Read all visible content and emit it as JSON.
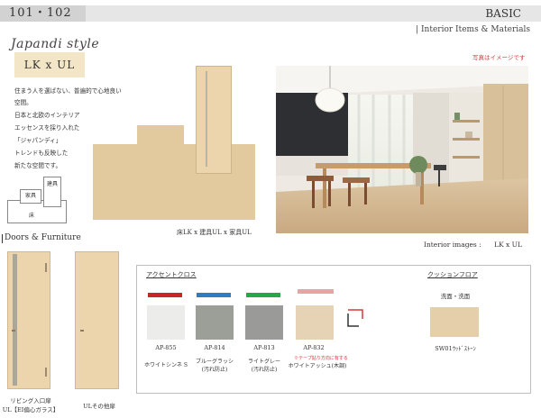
{
  "header": {
    "room_no": "101・102",
    "grade": "BASIC",
    "subtitle": "| Interior Items & Materials"
  },
  "style": {
    "title": "Japandi style",
    "spec": "LK x UL",
    "desc_lines": [
      "住まう人を選ばない、普遍的で心地良い",
      "空間。",
      "日本と北欧のインテリア",
      "エッセンスを採り入れた",
      "「ジャパンディ」",
      "トレンドも反映した",
      "新たな空間です。"
    ]
  },
  "diagram": {
    "labels": {
      "kagu": "家具",
      "kengu": "建具",
      "yuka": "床"
    }
  },
  "sample_caption": "床LK x 建具UL x 家具UL",
  "photo": {
    "note": "写真はイメージです",
    "caption_label": "Interior images :",
    "caption_value": "LK x UL"
  },
  "doors": {
    "section_title": "Doors & Furniture",
    "items": [
      {
        "caption_line1": "リビング入口扉",
        "caption_line2": "UL【EI偏心ガラス】"
      },
      {
        "caption_line1": "ULその他扉"
      }
    ]
  },
  "materials": {
    "accent_title": "アクセントクロス",
    "cushion_title": "クッションフロア",
    "accents": [
      {
        "code": "AP-855",
        "name": "ホワイトシンネ S",
        "bar_color": "#c62828",
        "swatch_color": "#ececea"
      },
      {
        "code": "AP-814",
        "name": "ブルーグラッシ",
        "sub": "(汚れ防止)",
        "bar_color": "#2e7dc0",
        "swatch_color": "#9c9e98"
      },
      {
        "code": "AP-813",
        "name": "ライトグレー",
        "sub": "(汚れ防止)",
        "bar_color": "#2aa64a",
        "swatch_color": "#9a9b98"
      },
      {
        "code": "AP-832",
        "name": "ホワイトアッシュ(木調)",
        "note": "※テープ貼り方向に有する",
        "swatch_color": "#e6d3b6"
      }
    ],
    "cushion": {
      "location": "洗面・洗面",
      "code": "SW01ｳｯﾄﾞｽﾄｰﾝ",
      "swatch_color": "#e5cfaa"
    }
  }
}
